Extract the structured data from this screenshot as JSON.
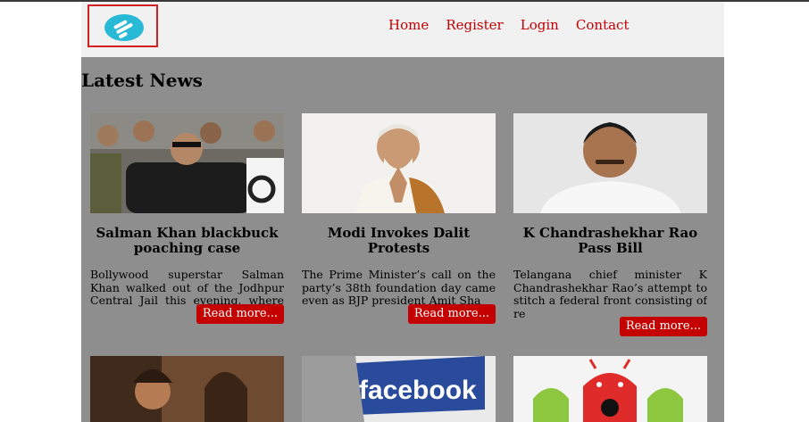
{
  "nav": {
    "links": [
      "Home",
      "Register",
      "Login",
      "Contact"
    ]
  },
  "main": {
    "title": "Latest News",
    "cards": [
      {
        "title": "Salman Khan blackbuck poaching case",
        "excerpt": "Bollywood superstar Salman Khan walked out of the Jodhpur Central Jail this evening, where he spent",
        "read_more": "Read more..."
      },
      {
        "title": "Modi Invokes Dalit Protests",
        "excerpt": "The Prime Minister’s call on the party’s 38th foundation day came even as BJP president Amit Sha",
        "read_more": "Read more..."
      },
      {
        "title": "K Chandrashekhar Rao Pass Bill",
        "excerpt": "Telangana chief minister K Chandrashekhar Rao’s attempt to stitch a federal front consisting of re",
        "read_more": "Read more..."
      },
      {
        "image_text": "facebook"
      }
    ]
  },
  "colors": {
    "link": "#c40000",
    "button": "#c40000",
    "navbar_bg": "#f1f1f1",
    "content_bg": "#8e8e8e",
    "logo": "#27b9d6"
  }
}
